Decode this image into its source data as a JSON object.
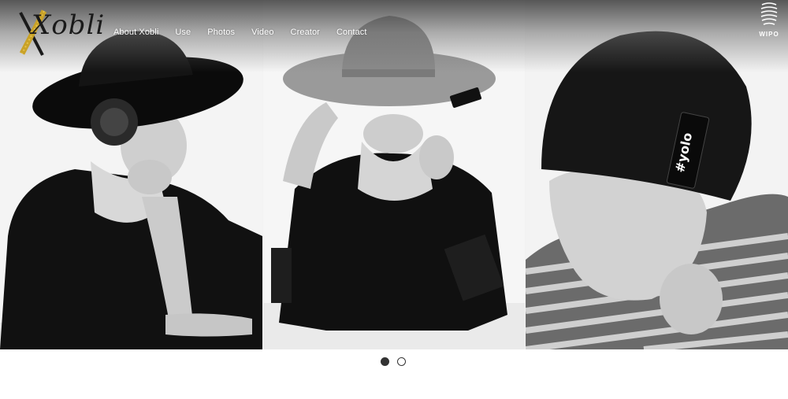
{
  "logo": {
    "text": "Xobli"
  },
  "nav": {
    "items": [
      {
        "label": "About Xobli"
      },
      {
        "label": "Use"
      },
      {
        "label": "Photos"
      },
      {
        "label": "Video"
      },
      {
        "label": "Creator"
      },
      {
        "label": "Contact"
      }
    ]
  },
  "badge": {
    "label": "WIPO"
  },
  "slider": {
    "panels": [
      {
        "subject": "woman-black-wide-brim-hat-feather-brooch"
      },
      {
        "subject": "woman-grey-wide-brim-hat-covering-eyes"
      },
      {
        "subject": "man-black-knit-beanie-yolo-tag"
      }
    ],
    "hat_tag": "#yolo",
    "pages": 2,
    "active_page": 1
  },
  "colors": {
    "nav_text": "#ffffff",
    "dot": "#333333",
    "background": "#ffffff"
  }
}
